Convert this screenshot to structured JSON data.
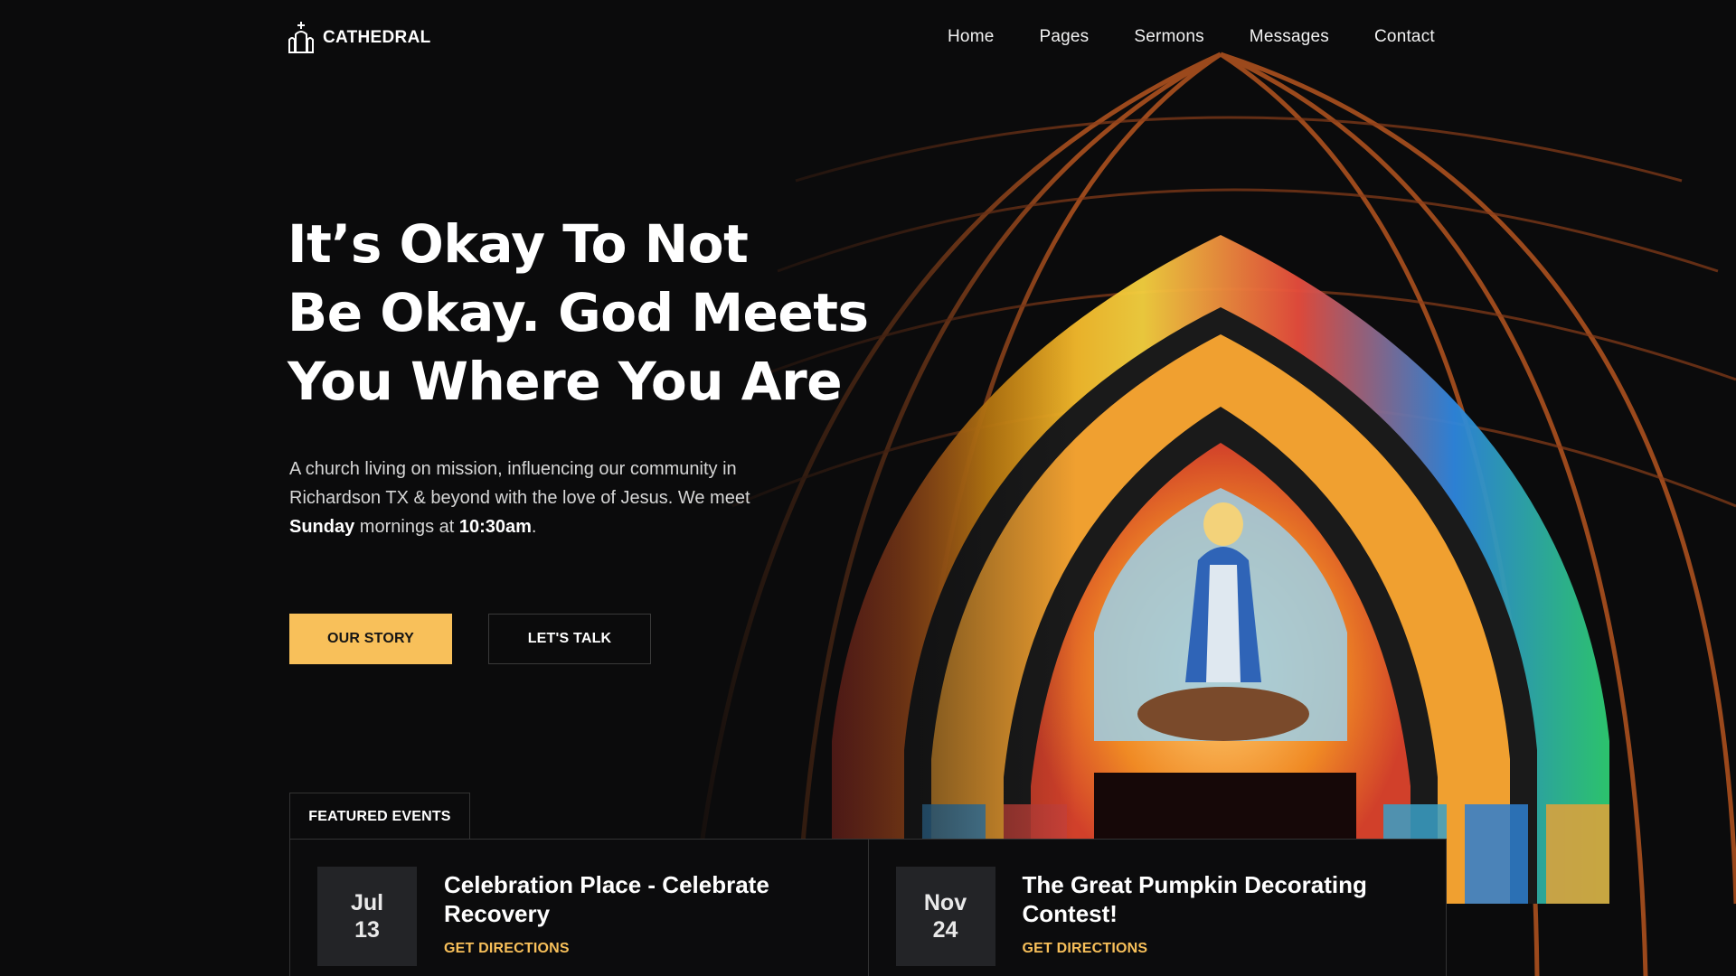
{
  "brand": {
    "name": "CATHEDRAL"
  },
  "nav": {
    "items": [
      "Home",
      "Pages",
      "Sermons",
      "Messages",
      "Contact"
    ]
  },
  "hero": {
    "title_lines": [
      "It’s Okay To Not",
      "Be Okay. God Meets",
      "You Where You Are"
    ],
    "desc_line1": "A church living on mission, influencing our community in",
    "desc_line2": "Richardson TX & beyond with the love of Jesus. We meet",
    "desc_bold_day": "Sunday",
    "desc_mid": " mornings at ",
    "desc_bold_time": "10:30am",
    "desc_end": "."
  },
  "buttons": {
    "primary": "OUR STORY",
    "secondary": "LET'S TALK"
  },
  "events": {
    "tab_label": "FEATURED EVENTS",
    "items": [
      {
        "month": "Jul",
        "day": "13",
        "title": "Celebration Place - Celebrate Recovery",
        "link": "GET DIRECTIONS"
      },
      {
        "month": "Nov",
        "day": "24",
        "title": "The Great Pumpkin Decorating Contest!",
        "link": "GET DIRECTIONS"
      }
    ]
  },
  "colors": {
    "accent": "#f8c05a",
    "background": "#0b0b0c",
    "date_box": "#232427"
  },
  "icons": {
    "logo": "church-icon"
  }
}
